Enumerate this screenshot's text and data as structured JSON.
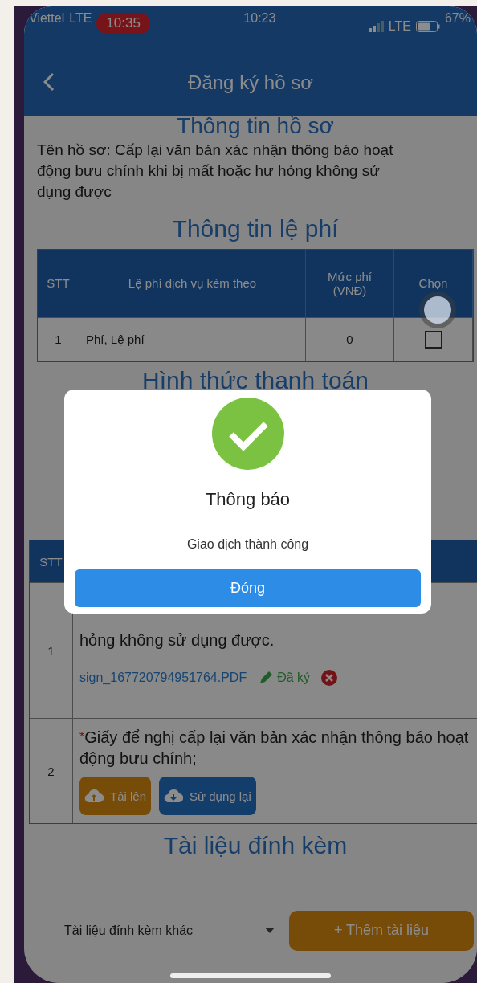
{
  "status_bar": {
    "carrier": "Viettel",
    "carrier_network": "LTE",
    "recording_time": "10:35",
    "time": "10:23",
    "network": "LTE",
    "battery": "67%"
  },
  "header": {
    "title": "Đăng ký hồ sơ"
  },
  "profile_section": {
    "heading": "Thông tin hồ sơ",
    "text": "Tên hồ sơ: Cấp lại văn bản xác nhận thông báo hoạt động bưu chính khi bị mất hoặc hư hỏng không sử dụng được"
  },
  "fee_section": {
    "heading": "Thông tin lệ phí",
    "columns": [
      "STT",
      "Lệ phí dịch vụ kèm theo",
      "Mức phí (VNĐ)",
      "Chọn"
    ],
    "rows": [
      {
        "index": "1",
        "name": "Phí, Lệ phí",
        "amount": "0",
        "checked": false
      }
    ]
  },
  "payment_section": {
    "heading": "Hình thức thanh toán"
  },
  "documents_table": {
    "columns": [
      "STT"
    ],
    "rows": [
      {
        "index": "1",
        "kind": "signed",
        "text": "hỏng không sử dụng được.",
        "file": "sign_167720794951764.PDF",
        "status": "Đã ký"
      },
      {
        "index": "2",
        "kind": "upload",
        "marker": "*",
        "text": "Giấy để nghị cấp lại văn bản xác nhận thông báo hoạt động bưu chính;",
        "buttons": [
          {
            "label": "Tải lên",
            "kind": "upload"
          },
          {
            "label": "Sử dụng lại",
            "kind": "reuse"
          }
        ]
      }
    ]
  },
  "attachments": {
    "heading": "Tài liệu đính kèm",
    "select_value": "Tài liệu đính kèm khác",
    "add_button": "+ Thêm tài liệu"
  },
  "dialog": {
    "title": "Thông báo",
    "message": "Giao dịch thành công",
    "button": "Đóng"
  }
}
